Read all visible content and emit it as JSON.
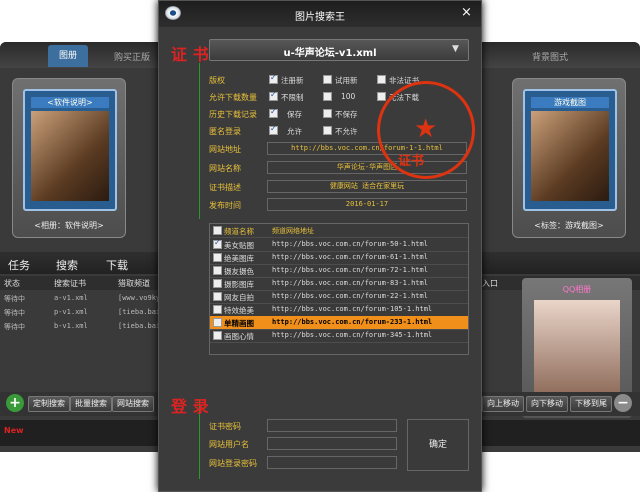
{
  "bg": {
    "tabs": [
      "图册",
      "购买正版",
      "背景图式"
    ],
    "shelves": [
      {
        "title": "<软件说明>",
        "caption": "<相册：软件说明>"
      },
      {
        "title": "游戏截图",
        "caption": "<标签：游戏截图>"
      }
    ],
    "lower_tabs": [
      "任务",
      "搜索",
      "下载"
    ],
    "table_headers": [
      "状态",
      "搜索证书",
      "猎取频道",
      "入口"
    ],
    "rows": [
      {
        "status": "等待中",
        "cert": "a-v1.xml",
        "chan": "[www.vo9ky"
      },
      {
        "status": "等待中",
        "cert": "p-v1.xml",
        "chan": "[tieba.bai"
      },
      {
        "status": "等待中",
        "cert": "b-v1.xml",
        "chan": "[tieba.bai"
      }
    ],
    "qq_title": "QQ相册",
    "bottom_buttons_left": [
      "定制搜索",
      "批量搜索",
      "网站搜索"
    ],
    "bottom_buttons_right": [
      "向上移动",
      "向下移动",
      "下移到尾"
    ],
    "plus": "+",
    "minus": "−",
    "new_label": "New"
  },
  "dialog": {
    "title": "图片搜索王",
    "close": "×",
    "cert_header": "证 书",
    "cert_file": "u-华声论坛-v1.xml",
    "rows": {
      "copyright": "版权",
      "allow_dl_count": "允许下载数量",
      "history_dl": "历史下载记录",
      "anon_login": "匿名登录",
      "site_addr": "网站地址",
      "site_name": "网站名称",
      "cert_desc": "证书描述",
      "publish_time": "发布时间"
    },
    "options": {
      "registered": "注册新",
      "trial": "试用新",
      "illegal": "非法证书",
      "unlimited": "不限制",
      "count_value": "100",
      "no_download": "无法下载",
      "save": "保存",
      "no_save": "不保存",
      "allow": "允许",
      "disallow": "不允许"
    },
    "values": {
      "site_addr": "http://bbs.voc.com.cn/forum-1-1.html",
      "site_name": "华声论坛-华声图区",
      "cert_desc": "健康网站 适合在家里玩",
      "publish_time": "2016-01-17"
    },
    "stamp_text": "证书",
    "grid_headers": {
      "name": "频道名称",
      "url": "频道网络地址"
    },
    "channels": [
      {
        "name": "美女贴图",
        "url": "http://bbs.voc.com.cn/forum-50-1.html",
        "checked": true
      },
      {
        "name": "绝美图库",
        "url": "http://bbs.voc.com.cn/forum-61-1.html",
        "checked": false
      },
      {
        "name": "摄友摄色",
        "url": "http://bbs.voc.com.cn/forum-72-1.html",
        "checked": false
      },
      {
        "name": "摄影图库",
        "url": "http://bbs.voc.com.cn/forum-83-1.html",
        "checked": false
      },
      {
        "name": "网友自拍",
        "url": "http://bbs.voc.com.cn/forum-22-1.html",
        "checked": false
      },
      {
        "name": "特效绝美",
        "url": "http://bbs.voc.com.cn/forum-105-1.html",
        "checked": false
      },
      {
        "name": "单精画图",
        "url": "http://bbs.voc.com.cn/forum-233-1.html",
        "checked": false,
        "selected": true
      },
      {
        "name": "画图心情",
        "url": "http://bbs.voc.com.cn/forum-345-1.html",
        "checked": false
      }
    ],
    "login_header": "登 录",
    "login": {
      "cert_password": "证书密码",
      "site_user": "网站用户名",
      "site_password": "网站登录密码",
      "confirm": "确定"
    },
    "colors": {
      "accent": "#e8c13a",
      "red": "#d22222",
      "selected_row": "#f0901a",
      "green_line": "#2a9a2a"
    }
  }
}
